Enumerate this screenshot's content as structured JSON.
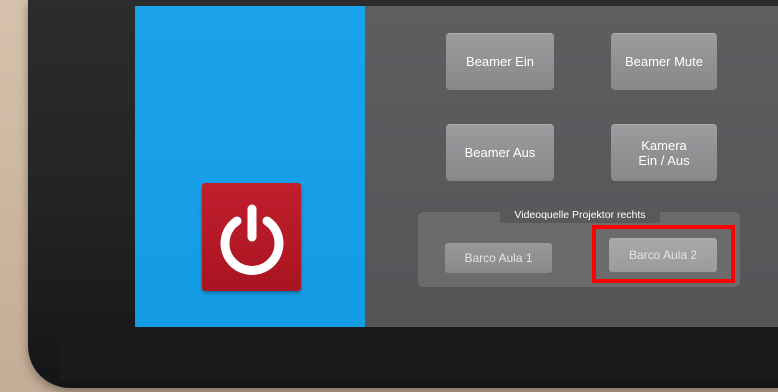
{
  "colors": {
    "accent_blue": "#1aa2ea",
    "power_red": "#b51a27",
    "button_gray": "#929295",
    "panel_gray": "#59595c",
    "highlight_red": "#ff0000"
  },
  "power": {
    "icon": "power-icon"
  },
  "controls": {
    "beamer_ein": "Beamer Ein",
    "beamer_mute": "Beamer Mute",
    "beamer_aus": "Beamer Aus",
    "kamera": "Kamera\nEin / Aus"
  },
  "video_source": {
    "title": "Videoquelle Projektor rechts",
    "options": [
      {
        "label": "Barco Aula 1",
        "selected": false
      },
      {
        "label": "Barco Aula 2",
        "selected": true
      }
    ]
  }
}
